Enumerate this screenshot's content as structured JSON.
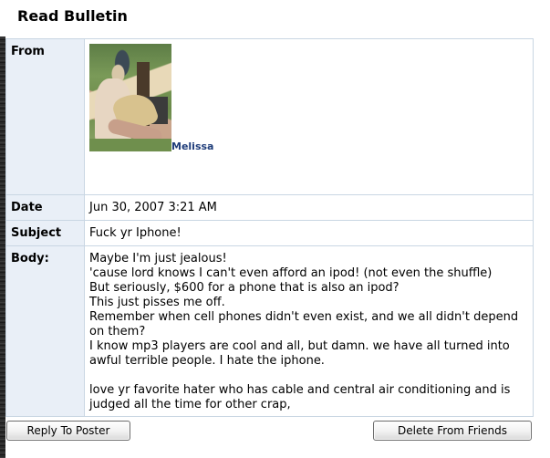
{
  "page": {
    "title": "Read Bulletin"
  },
  "bulletin": {
    "labels": {
      "from": "From",
      "date": "Date",
      "subject": "Subject",
      "body": "Body:"
    },
    "from": {
      "name": "Melissa",
      "avatar": "profile-photo"
    },
    "date": "Jun 30, 2007 3:21 AM",
    "subject": "Fuck yr Iphone!",
    "body_lines": [
      "Maybe I'm just jealous!",
      "'cause lord knows I can't even afford an ipod! (not even the shuffle)",
      "But seriously, $600 for a phone that is also an ipod?",
      "This just pisses me off.",
      "Remember when cell phones didn't even exist, and we all didn't depend on them?",
      "I know mp3 players are cool and all, but damn. we have all turned into awful terrible people. I hate the iphone.",
      "",
      "love yr favorite hater who has cable and central air conditioning and is judged all the time for other crap,"
    ]
  },
  "actions": {
    "reply_label": "Reply To Poster",
    "delete_label": "Delete From Friends"
  }
}
